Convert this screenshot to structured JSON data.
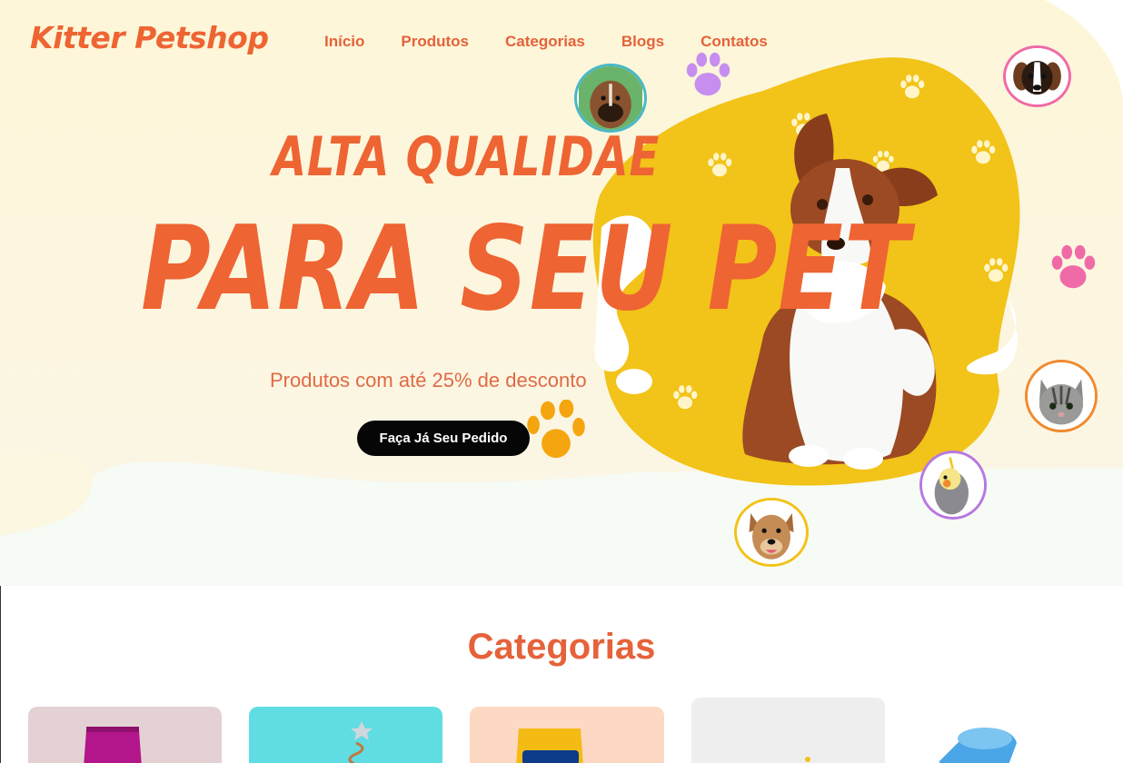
{
  "header": {
    "logo": "Kitter Petshop",
    "nav": [
      "Início",
      "Produtos",
      "Categorias",
      "Blogs",
      "Contatos"
    ]
  },
  "hero": {
    "headline_line1": "ALTA QUALIDAE",
    "headline_line2": "PARA SEU PET",
    "subtitle": "Produtos com até 25% de desconto",
    "cta_label": "Faça Já Seu Pedido"
  },
  "categories": {
    "title": "Categorias"
  },
  "colors": {
    "accent": "#ee6433",
    "blob_yellow": "#f2c318",
    "bg_cream": "#fdf7dc",
    "paw_purple": "#c78ef0",
    "paw_pink": "#f06aa8",
    "paw_orange": "#f5a50f",
    "cta_bg": "#060606"
  }
}
